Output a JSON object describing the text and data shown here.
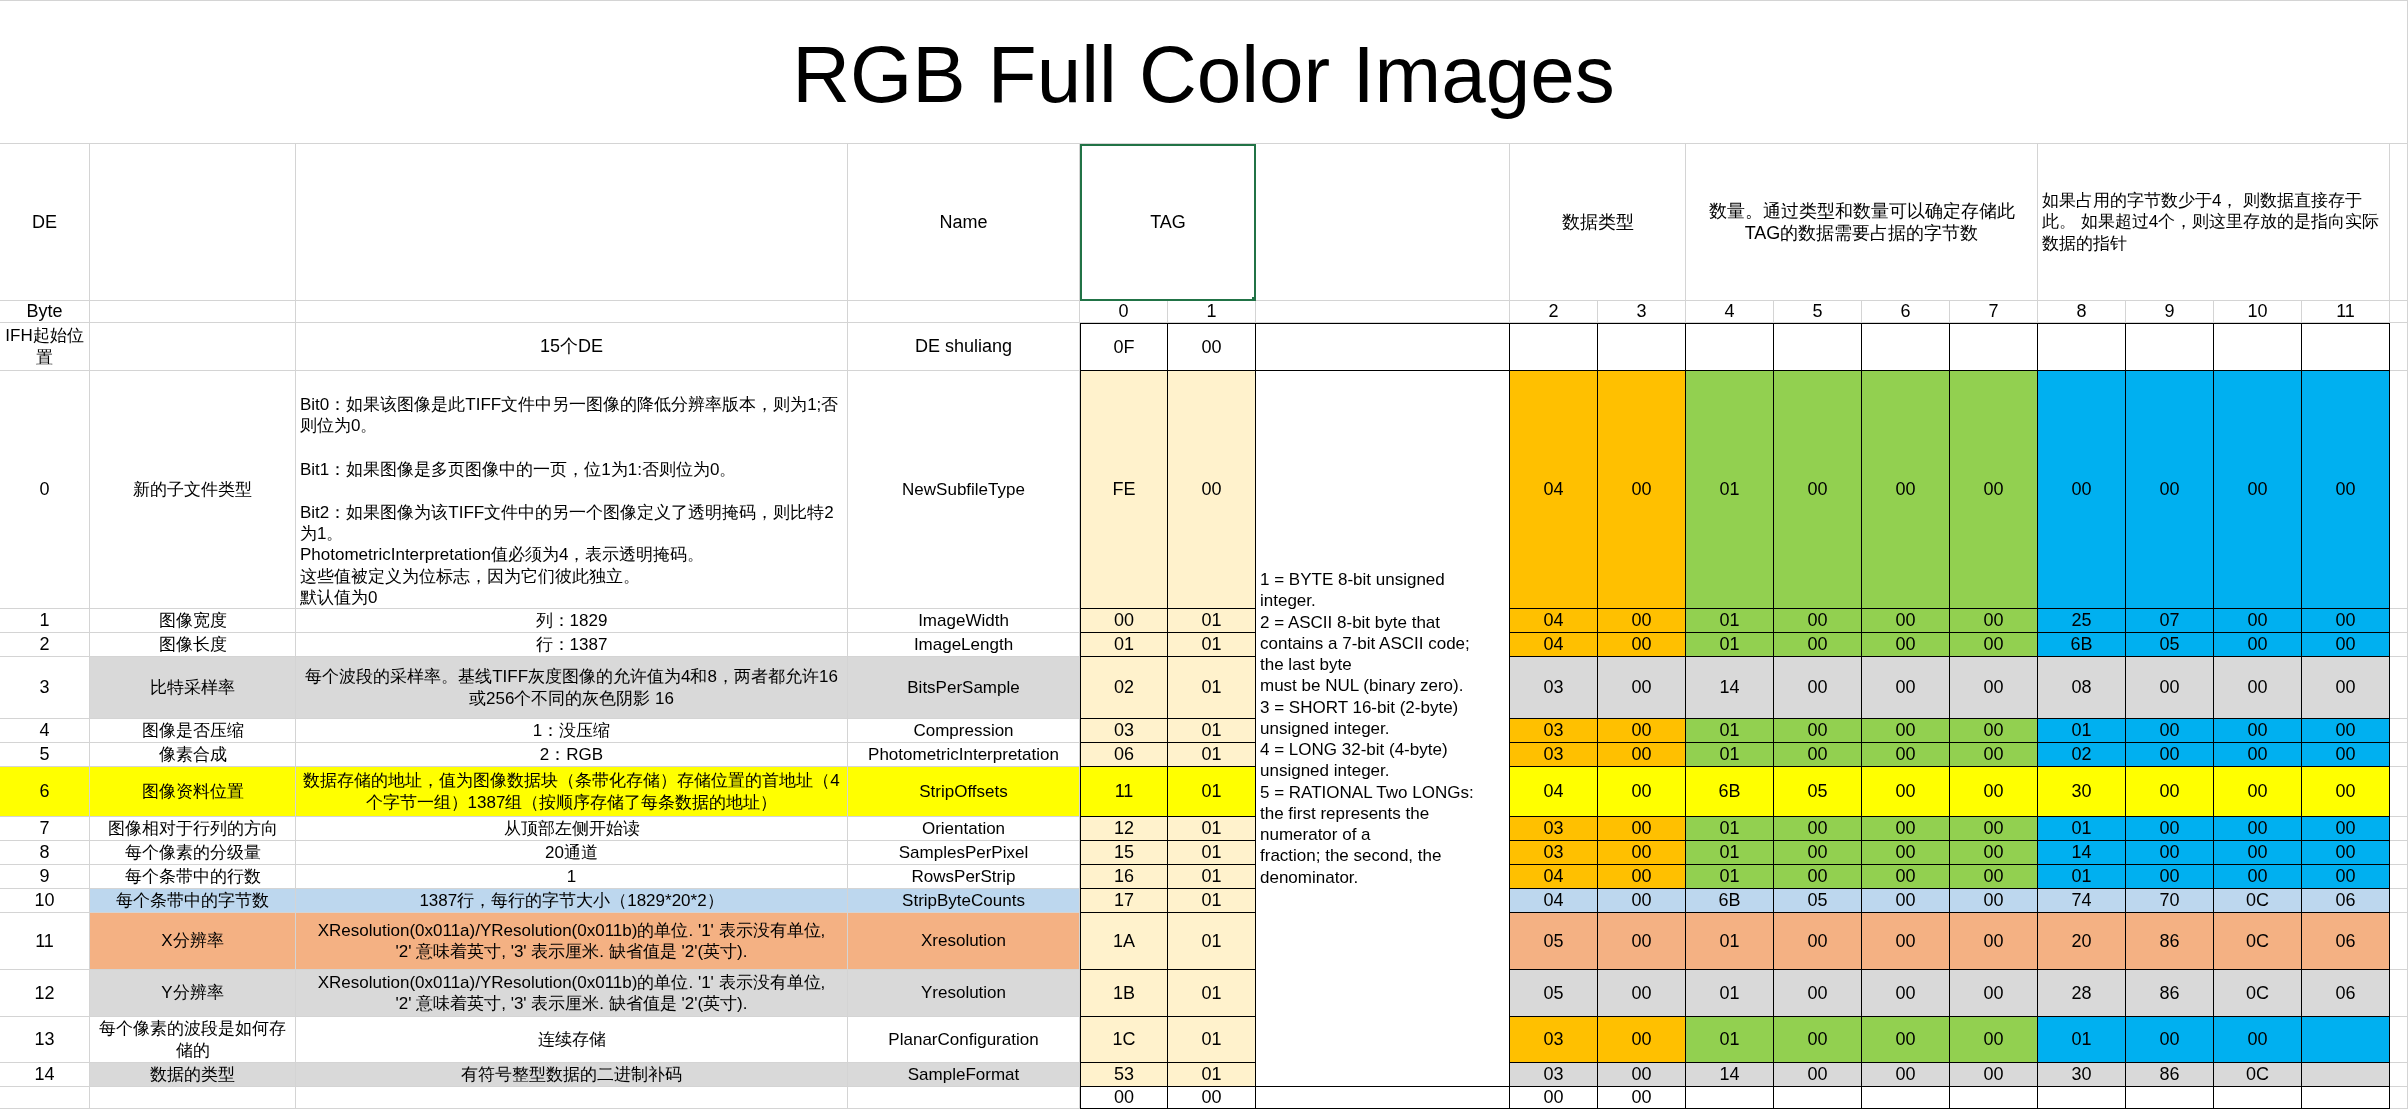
{
  "title": "RGB Full Color Images",
  "headers": {
    "de": "DE",
    "name": "Name",
    "tag": "TAG",
    "type": "数据类型",
    "count": "数量。通过类型和数量可以确定存储此\nTAG的数据需要占据的字节数",
    "value": "如果占用的字节数少于4， 则数据直接存于此。 如果超过4个，则这里存放的是指向实际数据的指针"
  },
  "byte_row": {
    "label": "Byte",
    "indices": [
      "0",
      "1",
      "2",
      "3",
      "4",
      "5",
      "6",
      "7",
      "8",
      "9",
      "10",
      "11"
    ]
  },
  "ifh_row": {
    "de": "IFH起始位置",
    "description": "15个DE",
    "name": "DE shuliang",
    "bytes": [
      "0F",
      "00"
    ]
  },
  "entries": [
    {
      "de": "0",
      "meaning": "新的子文件类型",
      "description": [
        "Bit0：如果该图像是此TIFF文件中另一图像的降低分辨率版本，则为1;否则位为0。",
        "Bit1：如果图像是多页图像中的一页，位1为1:否则位为0。",
        "Bit2：如果图像为该TIFF文件中的另一个图像定义了透明掩码，则比特2为1。",
        "PhotometricInterpretation值必须为4，表示透明掩码。",
        "这些值被定义为位标志，因为它们彼此独立。",
        "默认值为0"
      ],
      "name": "NewSubfileType",
      "kind": "plain",
      "bytes": [
        "FE",
        "00",
        "04",
        "00",
        "01",
        "00",
        "00",
        "00",
        "00",
        "00",
        "00",
        "00"
      ]
    },
    {
      "de": "1",
      "meaning": "图像宽度",
      "description": "列：1829",
      "name": "ImageWidth",
      "kind": "plain",
      "bytes": [
        "00",
        "01",
        "04",
        "00",
        "01",
        "00",
        "00",
        "00",
        "25",
        "07",
        "00",
        "00"
      ]
    },
    {
      "de": "2",
      "meaning": "图像长度",
      "description": "行：1387",
      "name": "ImageLength",
      "kind": "plain",
      "bytes": [
        "01",
        "01",
        "04",
        "00",
        "01",
        "00",
        "00",
        "00",
        "6B",
        "05",
        "00",
        "00"
      ]
    },
    {
      "de": "3",
      "meaning": "比特采样率",
      "description": "每个波段的采样率。基线TIFF灰度图像的允许值为4和8，两者都允许16或256个不同的灰色阴影 16",
      "name": "BitsPerSample",
      "kind": "gray",
      "bytes": [
        "02",
        "01",
        "03",
        "00",
        "14",
        "00",
        "00",
        "00",
        "08",
        "00",
        "00",
        "00"
      ]
    },
    {
      "de": "4",
      "meaning": "图像是否压缩",
      "description": "1：没压缩",
      "name": "Compression",
      "kind": "plain",
      "bytes": [
        "03",
        "01",
        "03",
        "00",
        "01",
        "00",
        "00",
        "00",
        "01",
        "00",
        "00",
        "00"
      ]
    },
    {
      "de": "5",
      "meaning": "像素合成",
      "description": "2：RGB",
      "name": "PhotometricInterpretation",
      "kind": "plain",
      "bytes": [
        "06",
        "01",
        "03",
        "00",
        "01",
        "00",
        "00",
        "00",
        "02",
        "00",
        "00",
        "00"
      ]
    },
    {
      "de": "6",
      "meaning": "图像资料位置",
      "description": "数据存储的地址，值为图像数据块（条带化存储）存储位置的首地址（4个字节一组）1387组（按顺序存储了每条数据的地址）",
      "name": "StripOffsets",
      "kind": "yellow",
      "bytes": [
        "11",
        "01",
        "04",
        "00",
        "6B",
        "05",
        "00",
        "00",
        "30",
        "00",
        "00",
        "00"
      ]
    },
    {
      "de": "7",
      "meaning": "图像相对于行列的方向",
      "description": "从顶部左侧开始读",
      "name": "Orientation",
      "kind": "plain",
      "bytes": [
        "12",
        "01",
        "03",
        "00",
        "01",
        "00",
        "00",
        "00",
        "01",
        "00",
        "00",
        "00"
      ]
    },
    {
      "de": "8",
      "meaning": "每个像素的分级量",
      "description": "20通道",
      "name": "SamplesPerPixel",
      "kind": "plain",
      "bytes": [
        "15",
        "01",
        "03",
        "00",
        "01",
        "00",
        "00",
        "00",
        "14",
        "00",
        "00",
        "00"
      ]
    },
    {
      "de": "9",
      "meaning": "每个条带中的行数",
      "description": "1",
      "name": "RowsPerStrip",
      "kind": "plain",
      "bytes": [
        "16",
        "01",
        "04",
        "00",
        "01",
        "00",
        "00",
        "00",
        "01",
        "00",
        "00",
        "00"
      ]
    },
    {
      "de": "10",
      "meaning": "每个条带中的字节数",
      "description": "1387行，每行的字节大小（1829*20*2）",
      "name": "StripByteCounts",
      "kind": "lightblue",
      "bytes": [
        "17",
        "01",
        "04",
        "00",
        "6B",
        "05",
        "00",
        "00",
        "74",
        "70",
        "0C",
        "06"
      ]
    },
    {
      "de": "11",
      "meaning": "X分辨率",
      "description": "XResolution(0x011a)/YResolution(0x011b)的单位. '1' 表示没有单位,\n'2' 意味着英寸, '3' 表示厘米. 缺省值是 '2'(英寸).",
      "name": "Xresolution",
      "kind": "salmon",
      "bytes": [
        "1A",
        "01",
        "05",
        "00",
        "01",
        "00",
        "00",
        "00",
        "20",
        "86",
        "0C",
        "06"
      ]
    },
    {
      "de": "12",
      "meaning": "Y分辨率",
      "description": "XResolution(0x011a)/YResolution(0x011b)的单位. '1' 表示没有单位,\n'2' 意味着英寸, '3' 表示厘米. 缺省值是 '2'(英寸).",
      "name": "Yresolution",
      "kind": "gray",
      "bytes": [
        "1B",
        "01",
        "05",
        "00",
        "01",
        "00",
        "00",
        "00",
        "28",
        "86",
        "0C",
        "06"
      ]
    },
    {
      "de": "13",
      "meaning": "每个像素的波段是如何存储的",
      "description": "连续存储",
      "name": "PlanarConfiguration",
      "kind": "plain",
      "bytes": [
        "1C",
        "01",
        "03",
        "00",
        "01",
        "00",
        "00",
        "00",
        "01",
        "00",
        "00"
      ]
    },
    {
      "de": "14",
      "meaning": "数据的类型",
      "description": "有符号整型数据的二进制补码",
      "name": "SampleFormat",
      "kind": "gray",
      "bytes": [
        "53",
        "01",
        "03",
        "00",
        "14",
        "00",
        "00",
        "00",
        "30",
        "86",
        "0C"
      ]
    }
  ],
  "type_legend": "1 = BYTE 8-bit unsigned\ninteger.\n2 = ASCII 8-bit byte that\ncontains a 7-bit ASCII code;\nthe last byte\nmust be NUL (binary zero).\n3 = SHORT 16-bit (2-byte)\nunsigned integer.\n4 = LONG 32-bit (4-byte)\nunsigned integer.\n5 = RATIONAL Two LONGs:\nthe first represents the\nnumerator of a\nfraction; the second, the\ndenominator.",
  "end_row": {
    "bytes": [
      "00",
      "00",
      "00",
      "00"
    ]
  }
}
